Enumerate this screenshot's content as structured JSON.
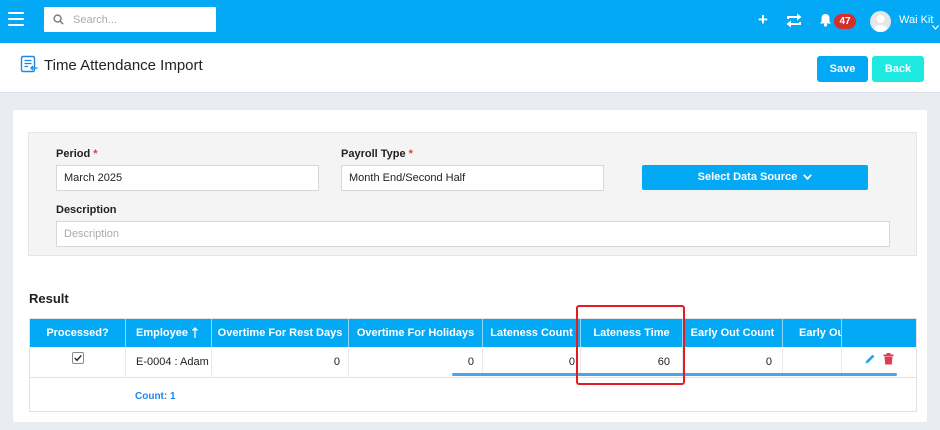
{
  "topbar": {
    "search_placeholder": "Search...",
    "notification_count": "47",
    "user_name": "Wai Kit"
  },
  "header": {
    "title": "Time Attendance Import",
    "save_label": "Save",
    "back_label": "Back"
  },
  "form": {
    "period_label": "Period",
    "period_value": "March 2025",
    "payroll_type_label": "Payroll Type",
    "payroll_type_value": "Month End/Second Half",
    "required_mark": "*",
    "select_data_source_label": "Select Data Source",
    "description_label": "Description",
    "description_placeholder": "Description"
  },
  "result": {
    "title": "Result",
    "columns": [
      "Processed?",
      "Employee",
      "Overtime For Rest Days",
      "Overtime For Holidays",
      "Lateness Count",
      "Lateness Time",
      "Early Out Count",
      "Early Out"
    ],
    "rows": [
      {
        "processed": true,
        "employee": "E-0004 : Adam",
        "overtime_rest_days": "0",
        "overtime_holidays": "0",
        "lateness_count": "0",
        "lateness_time": "60",
        "early_out_count": "0"
      }
    ],
    "count_label": "Count: 1"
  },
  "colors": {
    "primary": "#03a9f4",
    "accent_back": "#1de9e0",
    "badge": "#d32f2f",
    "delete": "#e53950",
    "highlight": "#e31b23"
  }
}
